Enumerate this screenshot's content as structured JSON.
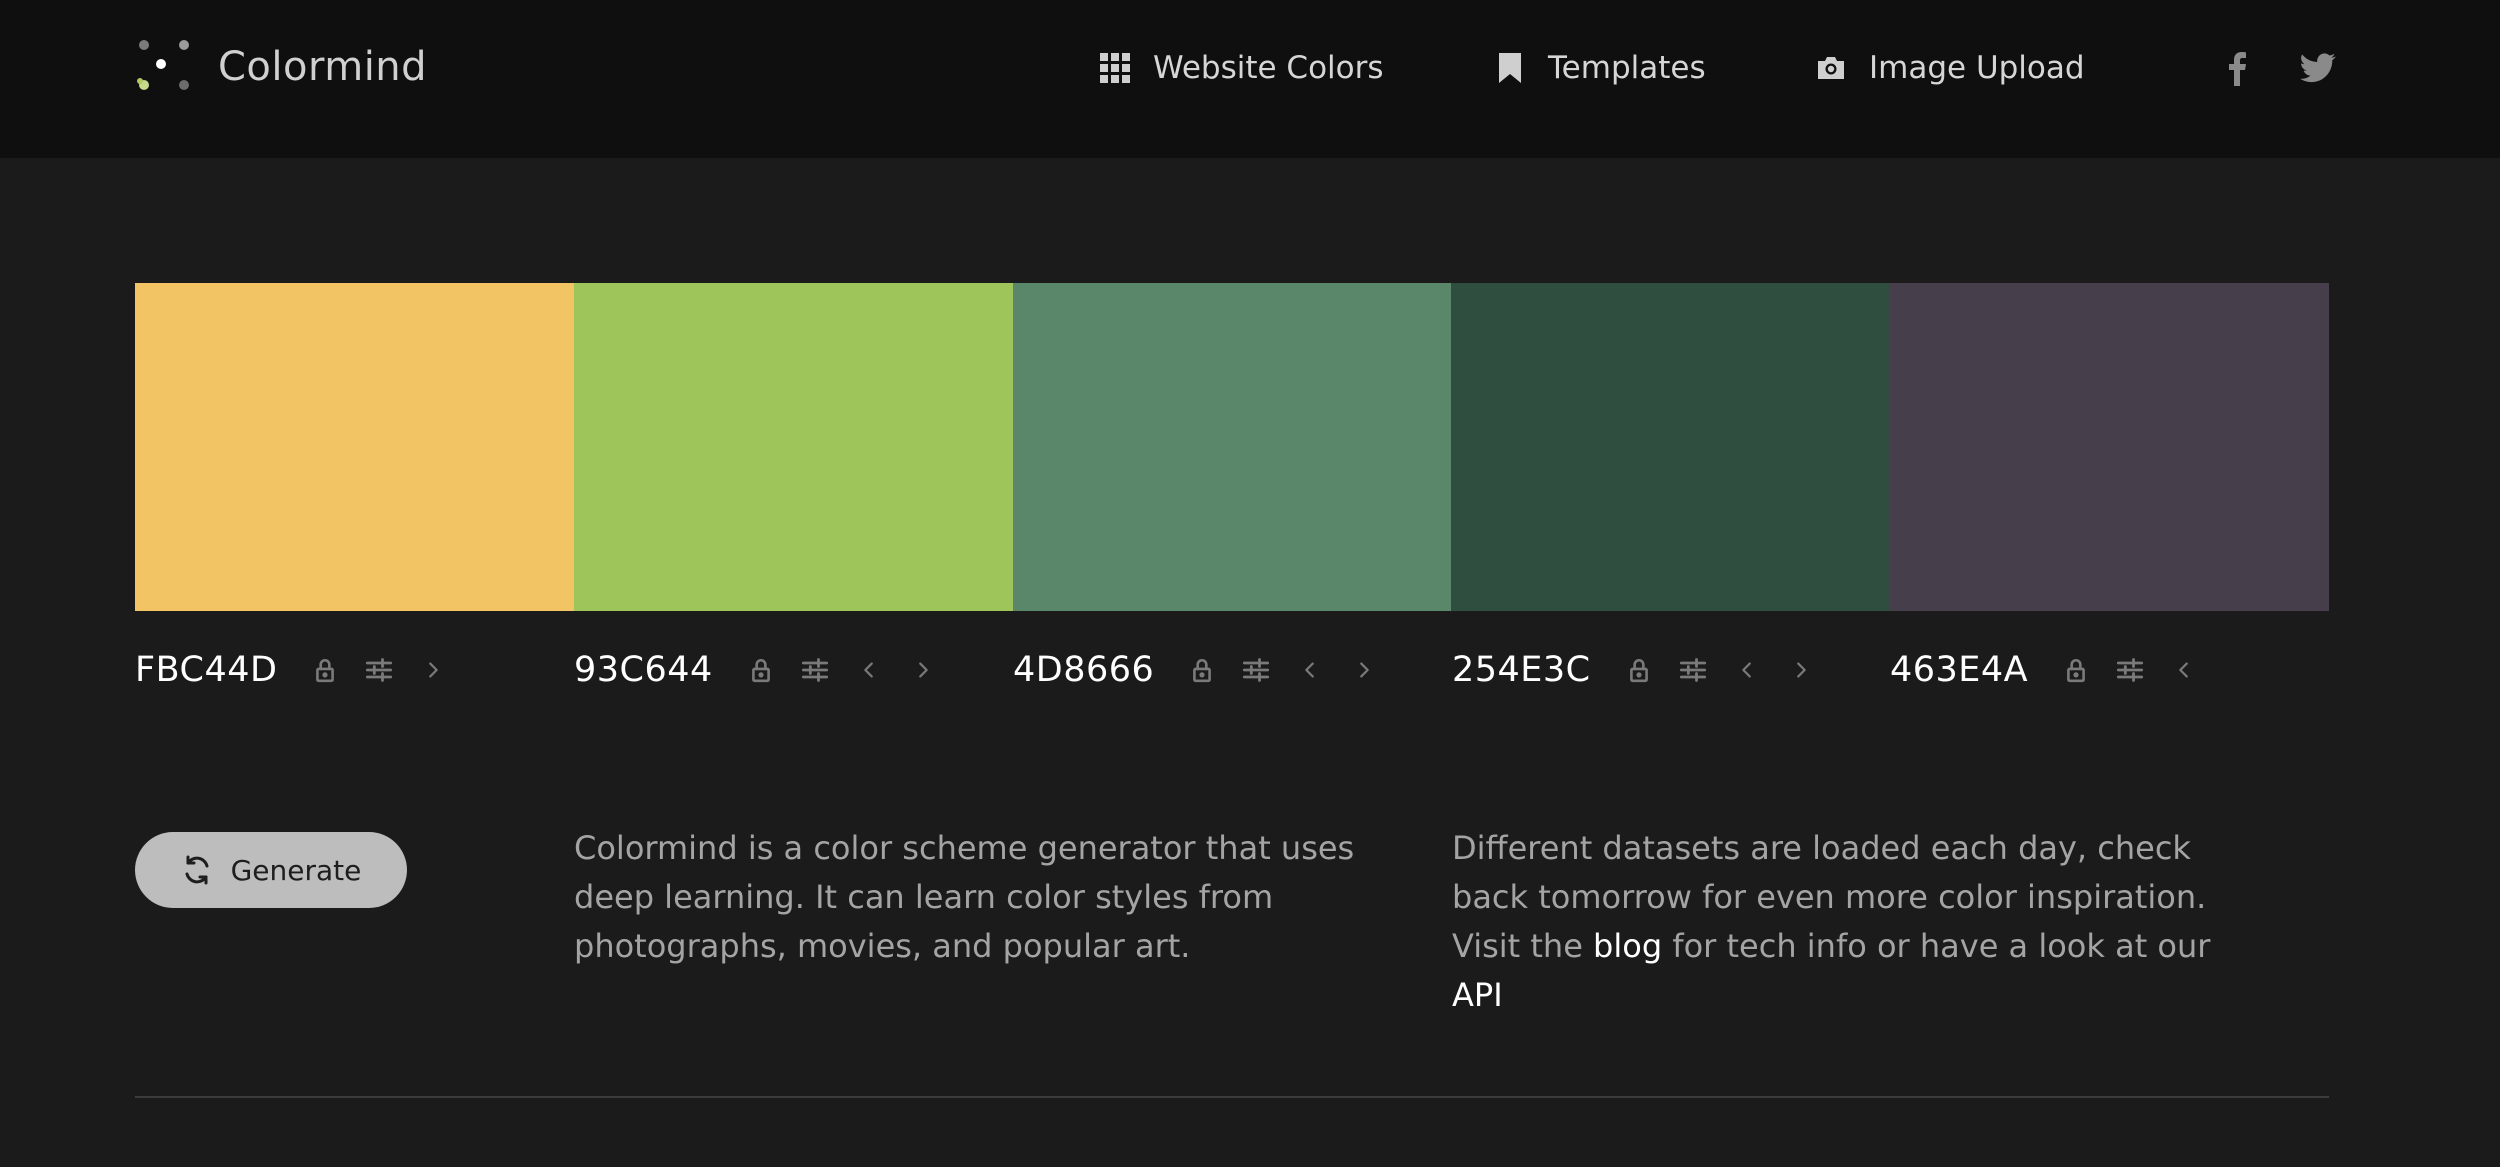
{
  "brand": {
    "name": "Colormind"
  },
  "nav": {
    "items": [
      {
        "label": "Website Colors",
        "icon": "grid-icon"
      },
      {
        "label": "Templates",
        "icon": "bookmark-icon"
      },
      {
        "label": "Image Upload",
        "icon": "camera-icon"
      }
    ],
    "social": [
      "facebook-icon",
      "twitter-icon"
    ]
  },
  "palette": {
    "swatches": [
      {
        "hex": "FBC44D",
        "color": "#F2C463"
      },
      {
        "hex": "93C644",
        "color": "#9EC55A"
      },
      {
        "hex": "4D8666",
        "color": "#5A876A"
      },
      {
        "hex": "254E3C",
        "color": "#2F4E3F"
      },
      {
        "hex": "463E4A",
        "color": "#463E4A"
      }
    ]
  },
  "generate": {
    "label": "Generate"
  },
  "about": {
    "text": "Colormind is a color scheme generator that uses deep learning. It can learn color styles from photographs, movies, and popular art."
  },
  "info": {
    "text_before": "Different datasets are loaded each day, check back tomorrow for even more color inspiration. Visit the ",
    "blog_link": "blog",
    "text_middle": " for tech info or have a look at our ",
    "api_link": "API"
  }
}
